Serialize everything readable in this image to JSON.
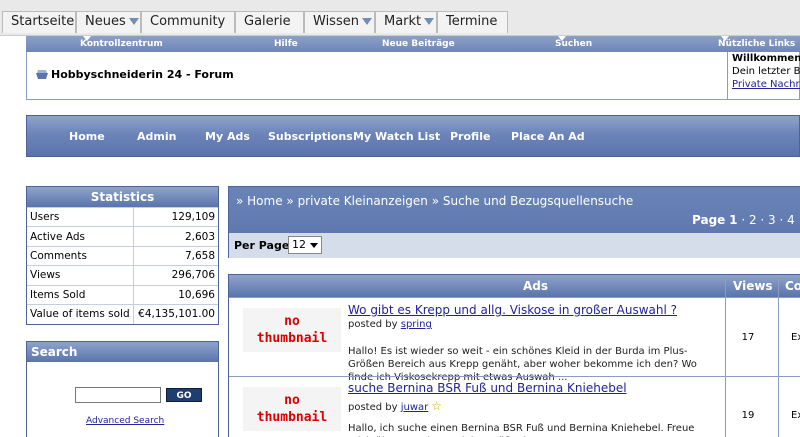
{
  "topnav": {
    "items": [
      "Startseite",
      "Neues",
      "Community",
      "Galerie",
      "Wissen",
      "Markt",
      "Termine"
    ]
  },
  "navbar": {
    "items": [
      "Kontrollzentrum",
      "Hilfe",
      "Neue Beiträge",
      "Suchen",
      "Nützliche Links"
    ]
  },
  "header": {
    "title": "Hobbyschneiderin 24 - Forum",
    "welcome_1": "Willkommen",
    "welcome_2": "Dein letzter B",
    "welcome_link": "Private Nachri"
  },
  "admenu": {
    "items": [
      "Home",
      "Admin",
      "My Ads",
      "Subscriptions",
      "My Watch List",
      "Profile",
      "Place An Ad"
    ]
  },
  "stats": {
    "title": "Statistics",
    "rows": [
      {
        "label": "Users",
        "value": "129,109"
      },
      {
        "label": "Active Ads",
        "value": "2,603"
      },
      {
        "label": "Comments",
        "value": "7,658"
      },
      {
        "label": "Views",
        "value": "296,706"
      },
      {
        "label": "Items Sold",
        "value": "10,696"
      },
      {
        "label": "Value of items sold",
        "value": "€4,135,101.00"
      }
    ]
  },
  "search": {
    "title": "Search",
    "go": "GO",
    "advanced": "Advanced Search"
  },
  "breadcrumb": {
    "path": "» Home » private Kleinanzeigen » Suche und Bezugsquellensuche",
    "page_label": "Page",
    "current_page": "1",
    "other_pages": "· 2 · 3 · 4",
    "per_page_label": "Per Page",
    "per_page_value": "12"
  },
  "ads": {
    "col_ads": "Ads",
    "col_views": "Views",
    "col_cond": "Co",
    "rows": [
      {
        "thumb_1": "no",
        "thumb_2": "thumbnail",
        "title": "Wo gibt es Krepp und allg. Viskose in großer Auswahl ?",
        "posted_by": "posted by",
        "user": "spring",
        "desc": "Hallo! Es ist wieder so weit - ein schönes Kleid in der Burda im Plus-Größen Bereich aus Krepp genäht, aber woher bekomme ich den? Wo finde ich Viskosekrepp mit etwas Auswah ...",
        "views": "17",
        "cond": "Ex"
      },
      {
        "thumb_1": "no",
        "thumb_2": "thumbnail",
        "title": "suche Bernina BSR Fuß und Bernina Kniehebel",
        "posted_by": "posted by",
        "user": "juwar",
        "desc": "Hallo, ich suche einen Bernina BSR Fuß und Bernina Kniehebel. Freue mich über Angebote. Liebe Grüße, juwar",
        "views": "19",
        "cond": "Ex"
      }
    ]
  }
}
